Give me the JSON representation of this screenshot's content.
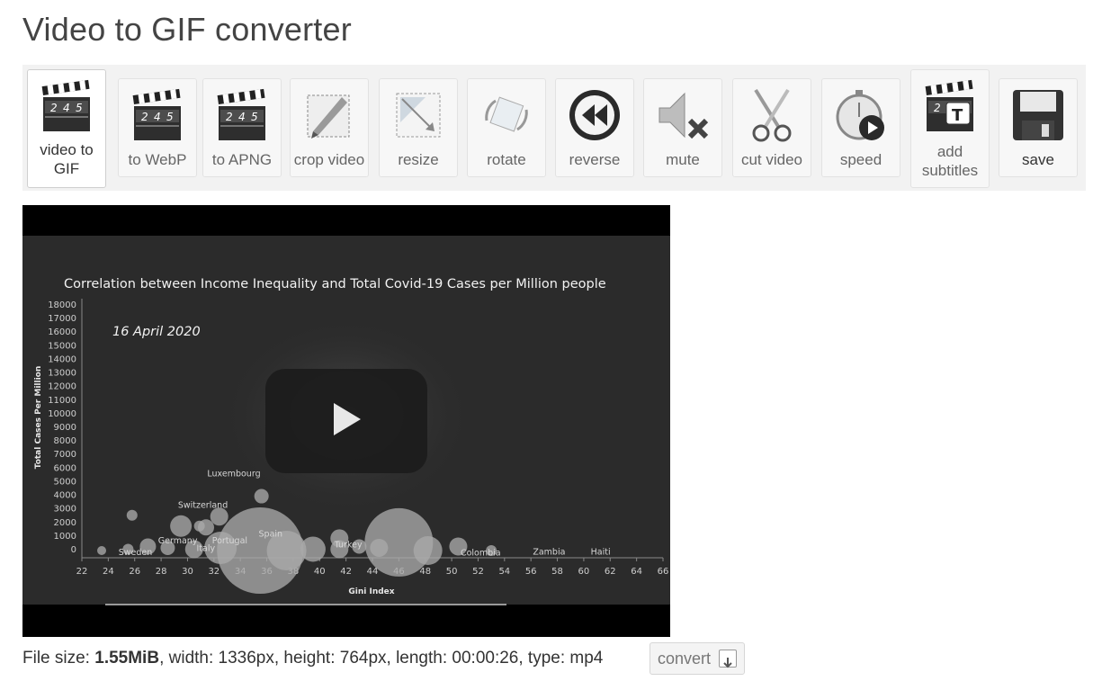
{
  "page": {
    "title": "Video to GIF converter"
  },
  "toolbar": {
    "items": [
      {
        "label": "video to GIF",
        "icon": "clapperboard-icon",
        "active": true
      },
      {
        "label": "to WebP",
        "icon": "clapperboard-icon"
      },
      {
        "label": "to APNG",
        "icon": "clapperboard-icon"
      },
      {
        "label": "crop video",
        "icon": "crop-icon"
      },
      {
        "label": "resize",
        "icon": "resize-icon"
      },
      {
        "label": "rotate",
        "icon": "rotate-icon"
      },
      {
        "label": "reverse",
        "icon": "rewind-icon"
      },
      {
        "label": "mute",
        "icon": "speaker-mute-icon"
      },
      {
        "label": "cut video",
        "icon": "scissors-icon"
      },
      {
        "label": "speed",
        "icon": "stopwatch-play-icon"
      },
      {
        "label": "add subtitles",
        "icon": "clapperboard-text-icon"
      },
      {
        "label": "save",
        "icon": "floppy-disk-icon"
      }
    ],
    "clapper_digits": [
      "2",
      "4",
      "5"
    ]
  },
  "video": {
    "frame": {
      "title": "Correlation between Income Inequality and Total Covid-19 Cases per Million people",
      "date": "16 April 2020",
      "ylabel": "Total Cases Per Million",
      "xlabel": "Gini Index"
    }
  },
  "chart_data": {
    "type": "scatter",
    "title": "Correlation between Income Inequality and Total Covid-19 Cases per Million people",
    "annotation": "16 April 2020",
    "xlabel": "Gini Index",
    "ylabel": "Total Cases Per Million",
    "xlim": [
      22,
      66
    ],
    "ylim": [
      0,
      18000
    ],
    "xticks": [
      22,
      24,
      26,
      28,
      30,
      32,
      34,
      36,
      38,
      40,
      42,
      44,
      46,
      48,
      50,
      52,
      54,
      56,
      58,
      60,
      62,
      64,
      66
    ],
    "yticks": [
      0,
      1000,
      2000,
      3000,
      4000,
      5000,
      6000,
      7000,
      8000,
      9000,
      10000,
      11000,
      12000,
      13000,
      14000,
      15000,
      16000,
      17000,
      18000
    ],
    "labeled_points": [
      {
        "name": "Luxembourg",
        "x": 34.9,
        "y": 4000
      },
      {
        "name": "Switzerland",
        "x": 32.0,
        "y": 2800
      },
      {
        "name": "Spain",
        "x": 36.0,
        "y": 1700
      },
      {
        "name": "Portugal",
        "x": 33.9,
        "y": 1600
      },
      {
        "name": "Germany",
        "x": 30.5,
        "y": 1600
      },
      {
        "name": "Italy",
        "x": 31.5,
        "y": 1700
      },
      {
        "name": "Sweden",
        "x": 27.5,
        "y": 1200
      },
      {
        "name": "Turkey",
        "x": 41.8,
        "y": 1300
      },
      {
        "name": "Colombia",
        "x": 50.4,
        "y": 700
      },
      {
        "name": "Zambia",
        "x": 57.1,
        "y": 100
      },
      {
        "name": "Haiti",
        "x": 60.8,
        "y": 100
      }
    ]
  },
  "file_info": {
    "prefix": "File size: ",
    "size": "1.55MiB",
    "rest": ", width: 1336px, height: 764px, length: 00:00:26, type: mp4"
  },
  "convert": {
    "label": "convert"
  }
}
